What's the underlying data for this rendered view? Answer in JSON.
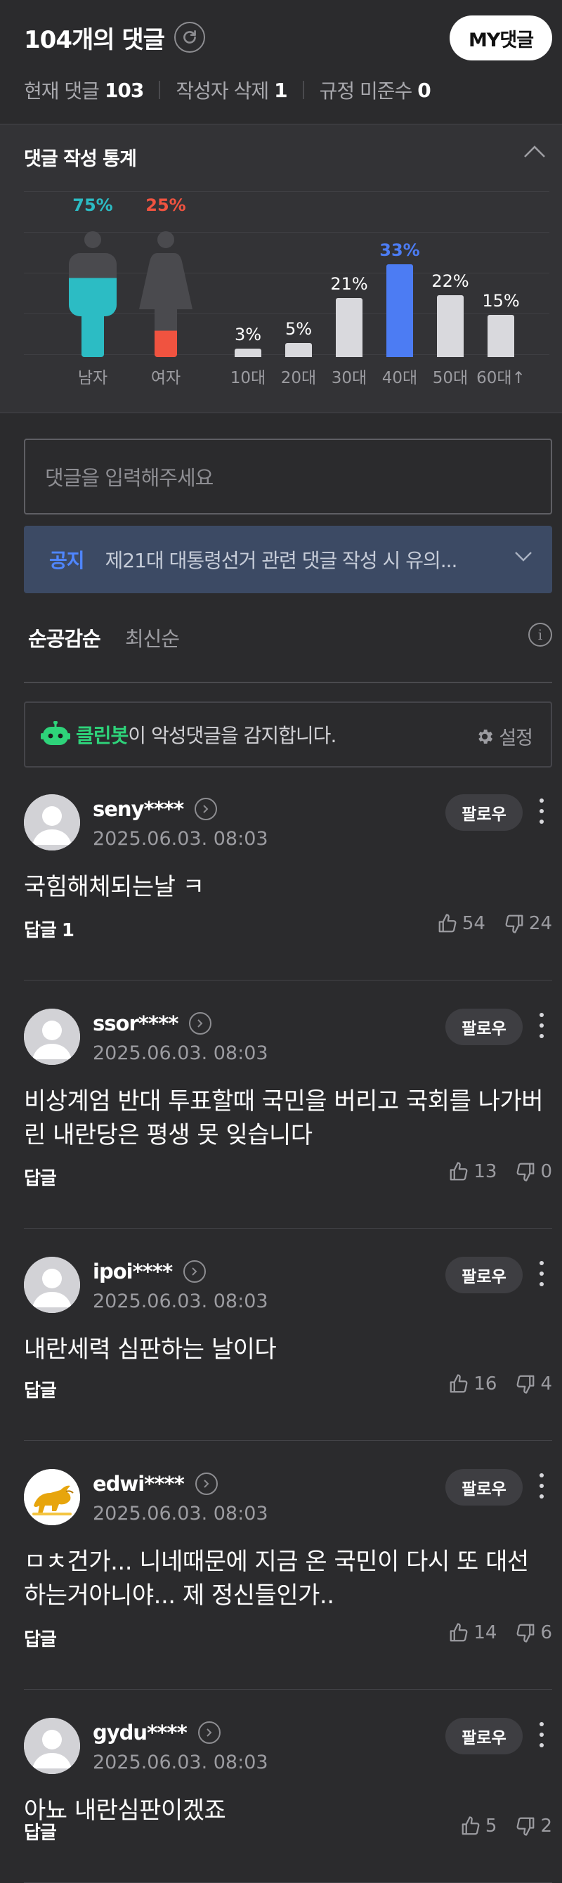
{
  "header": {
    "title": "104개의 댓글",
    "my_button": "MY댓글",
    "stats": [
      {
        "label": "현재 댓글",
        "value": "103"
      },
      {
        "label": "작성자 삭제",
        "value": "1"
      },
      {
        "label": "규정 미준수",
        "value": "0"
      }
    ]
  },
  "stats_panel": {
    "title": "댓글 작성 통계",
    "gender": [
      {
        "label": "남자",
        "percent": "75%",
        "value": 75,
        "color": "#2cbcc4"
      },
      {
        "label": "여자",
        "percent": "25%",
        "value": 25,
        "color": "#f05340"
      }
    ],
    "ages": [
      {
        "label": "10대",
        "percent": "3%",
        "value": 3
      },
      {
        "label": "20대",
        "percent": "5%",
        "value": 5
      },
      {
        "label": "30대",
        "percent": "21%",
        "value": 21
      },
      {
        "label": "40대",
        "percent": "33%",
        "value": 33,
        "highlight": true
      },
      {
        "label": "50대",
        "percent": "22%",
        "value": 22
      },
      {
        "label": "60대↑",
        "percent": "15%",
        "value": 15
      }
    ],
    "age_highlight_color": "#4c7cf3"
  },
  "input": {
    "placeholder": "댓글을 입력해주세요"
  },
  "notice": {
    "tag": "공지",
    "text": "제21대 대통령선거 관련 댓글 작성 시 유의..."
  },
  "sort": {
    "active": "순공감순",
    "other": "최신순"
  },
  "cleanbot": {
    "brand": "클린봇",
    "text": "이 악성댓글을 감지합니다.",
    "settings": "설정"
  },
  "comments": [
    {
      "user": "seny****",
      "date": "2025.06.03. 08:03",
      "follow": "팔로우",
      "body": "국힘해체되는날 ㅋ",
      "reply": "답글 1",
      "likes": "54",
      "dislikes": "24",
      "avatar": "default"
    },
    {
      "user": "ssor****",
      "date": "2025.06.03. 08:03",
      "follow": "팔로우",
      "body": "비상계엄 반대 투표할때 국민을 버리고 국회를 나가버린 내란당은 평생 못 잊습니다",
      "reply": "답글",
      "likes": "13",
      "dislikes": "0",
      "avatar": "default"
    },
    {
      "user": "ipoi****",
      "date": "2025.06.03. 08:03",
      "follow": "팔로우",
      "body": "내란세력 심판하는 날이다",
      "reply": "답글",
      "likes": "16",
      "dislikes": "4",
      "avatar": "default"
    },
    {
      "user": "edwi****",
      "date": "2025.06.03. 08:03",
      "follow": "팔로우",
      "body": "ㅁㅊ건가... 니네때문에 지금 온 국민이 다시 또 대선 하는거아니야... 제 정신들인가..",
      "reply": "답글",
      "likes": "14",
      "dislikes": "6",
      "avatar": "bull"
    },
    {
      "user": "gydu****",
      "date": "2025.06.03. 08:03",
      "follow": "팔로우",
      "body": "아뇨 내란심판이겠죠",
      "reply": "답글",
      "likes": "5",
      "dislikes": "2",
      "avatar": "default"
    }
  ]
}
